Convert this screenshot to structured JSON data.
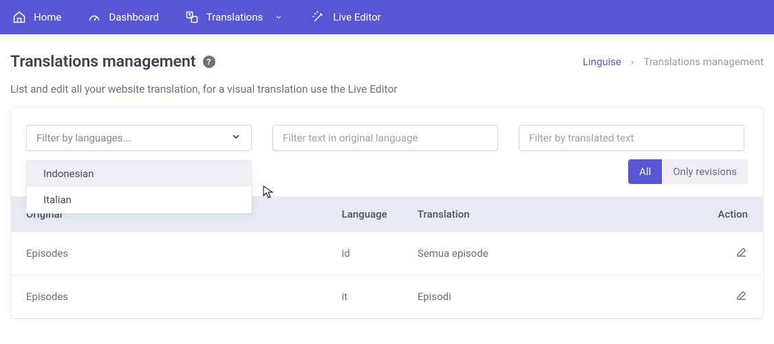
{
  "nav": {
    "home": "Home",
    "dashboard": "Dashboard",
    "translations": "Translations",
    "liveEditor": "Live Editor"
  },
  "header": {
    "title": "Translations management"
  },
  "breadcrumb": {
    "link": "Linguise",
    "sep": "›",
    "current": "Translations management"
  },
  "subtitle": "List and edit all your website translation, for a visual translation use the Live Editor",
  "filters": {
    "languagePlaceholder": "Filter by languages...",
    "originalPlaceholder": "Filter text in original language",
    "translatedPlaceholder": "Filter by translated text",
    "options": [
      "Indonesian",
      "Italian"
    ]
  },
  "toggle": {
    "all": "All",
    "revisions": "Only revisions"
  },
  "table": {
    "headers": {
      "original": "Original",
      "language": "Language",
      "translation": "Translation",
      "action": "Action"
    },
    "rows": [
      {
        "original": "Episodes",
        "language": "id",
        "translation": "Semua episode"
      },
      {
        "original": "Episodes",
        "language": "it",
        "translation": "Episodi"
      }
    ]
  }
}
